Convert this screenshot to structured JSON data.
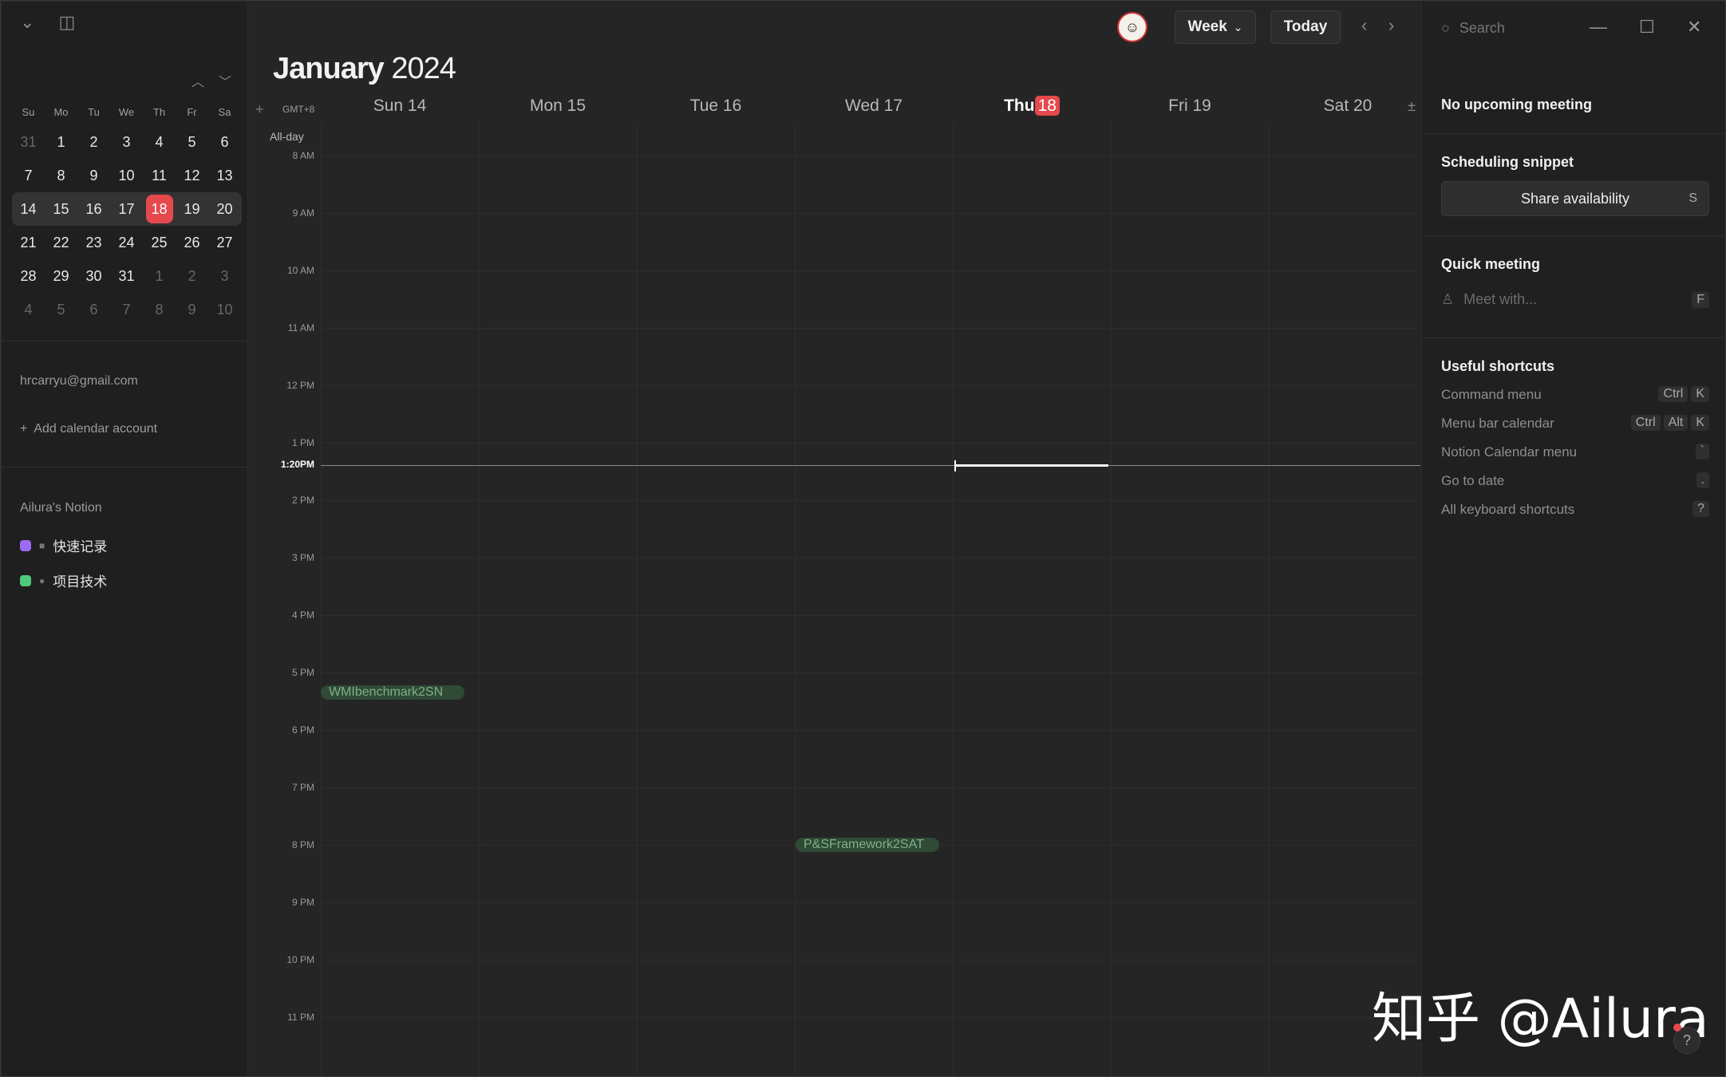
{
  "sidebar": {
    "mini_calendar": {
      "weekdays": [
        "Su",
        "Mo",
        "Tu",
        "We",
        "Th",
        "Fr",
        "Sa"
      ],
      "weeks": [
        [
          "31",
          "1",
          "2",
          "3",
          "4",
          "5",
          "6"
        ],
        [
          "7",
          "8",
          "9",
          "10",
          "11",
          "12",
          "13"
        ],
        [
          "14",
          "15",
          "16",
          "17",
          "18",
          "19",
          "20"
        ],
        [
          "21",
          "22",
          "23",
          "24",
          "25",
          "26",
          "27"
        ],
        [
          "28",
          "29",
          "30",
          "31",
          "1",
          "2",
          "3"
        ],
        [
          "4",
          "5",
          "6",
          "7",
          "8",
          "9",
          "10"
        ]
      ],
      "today": "18"
    },
    "account_email": "hrcarryu@gmail.com",
    "add_account_label": "Add calendar account",
    "workspace_title": "Ailura's Notion",
    "calendars": [
      {
        "label": "快速记录",
        "color": "#9b6bf2"
      },
      {
        "label": "项目技术",
        "color": "#4fc97a"
      }
    ]
  },
  "header": {
    "month": "January",
    "year": "2024",
    "view_label": "Week",
    "today_label": "Today",
    "timezone": "GMT+8",
    "all_day_label": "All-day",
    "days": [
      {
        "label": "Sun 14"
      },
      {
        "label": "Mon 15"
      },
      {
        "label": "Tue 16"
      },
      {
        "label": "Wed 17"
      },
      {
        "label": "Thu",
        "badge": "18"
      },
      {
        "label": "Fri 19"
      },
      {
        "label": "Sat 20"
      }
    ]
  },
  "grid": {
    "hours": [
      "8 AM",
      "9 AM",
      "10 AM",
      "11 AM",
      "12 PM",
      "1 PM",
      "2 PM",
      "3 PM",
      "4 PM",
      "5 PM",
      "6 PM",
      "7 PM",
      "8 PM",
      "9 PM",
      "10 PM",
      "11 PM"
    ],
    "now_label": "1:20PM",
    "events": [
      {
        "title": "WMIbenchmark2SN",
        "day": "Sun 14",
        "time": "5 PM"
      },
      {
        "title": "P&SFramework2SAT",
        "day": "Wed 17",
        "time": "8 PM"
      }
    ]
  },
  "right_panel": {
    "search_placeholder": "Search",
    "upcoming": "No upcoming meeting",
    "scheduling_title": "Scheduling snippet",
    "share_label": "Share availability",
    "share_key": "S",
    "quick_meeting_title": "Quick meeting",
    "meet_placeholder": "Meet with...",
    "meet_key": "F",
    "shortcuts_title": "Useful shortcuts",
    "shortcuts": [
      {
        "label": "Command menu",
        "keys": [
          "Ctrl",
          "K"
        ]
      },
      {
        "label": "Menu bar calendar",
        "keys": [
          "Ctrl",
          "Alt",
          "K"
        ]
      },
      {
        "label": "Notion Calendar menu",
        "keys": [
          "`"
        ]
      },
      {
        "label": "Go to date",
        "keys": [
          "."
        ]
      },
      {
        "label": "All keyboard shortcuts",
        "keys": [
          "?"
        ]
      }
    ]
  },
  "watermark": "知乎 @Ailura",
  "help_label": "?",
  "colors": {
    "today": "#e5484d",
    "event_bg": "#2f4a35",
    "event_text": "#7fb08a"
  }
}
